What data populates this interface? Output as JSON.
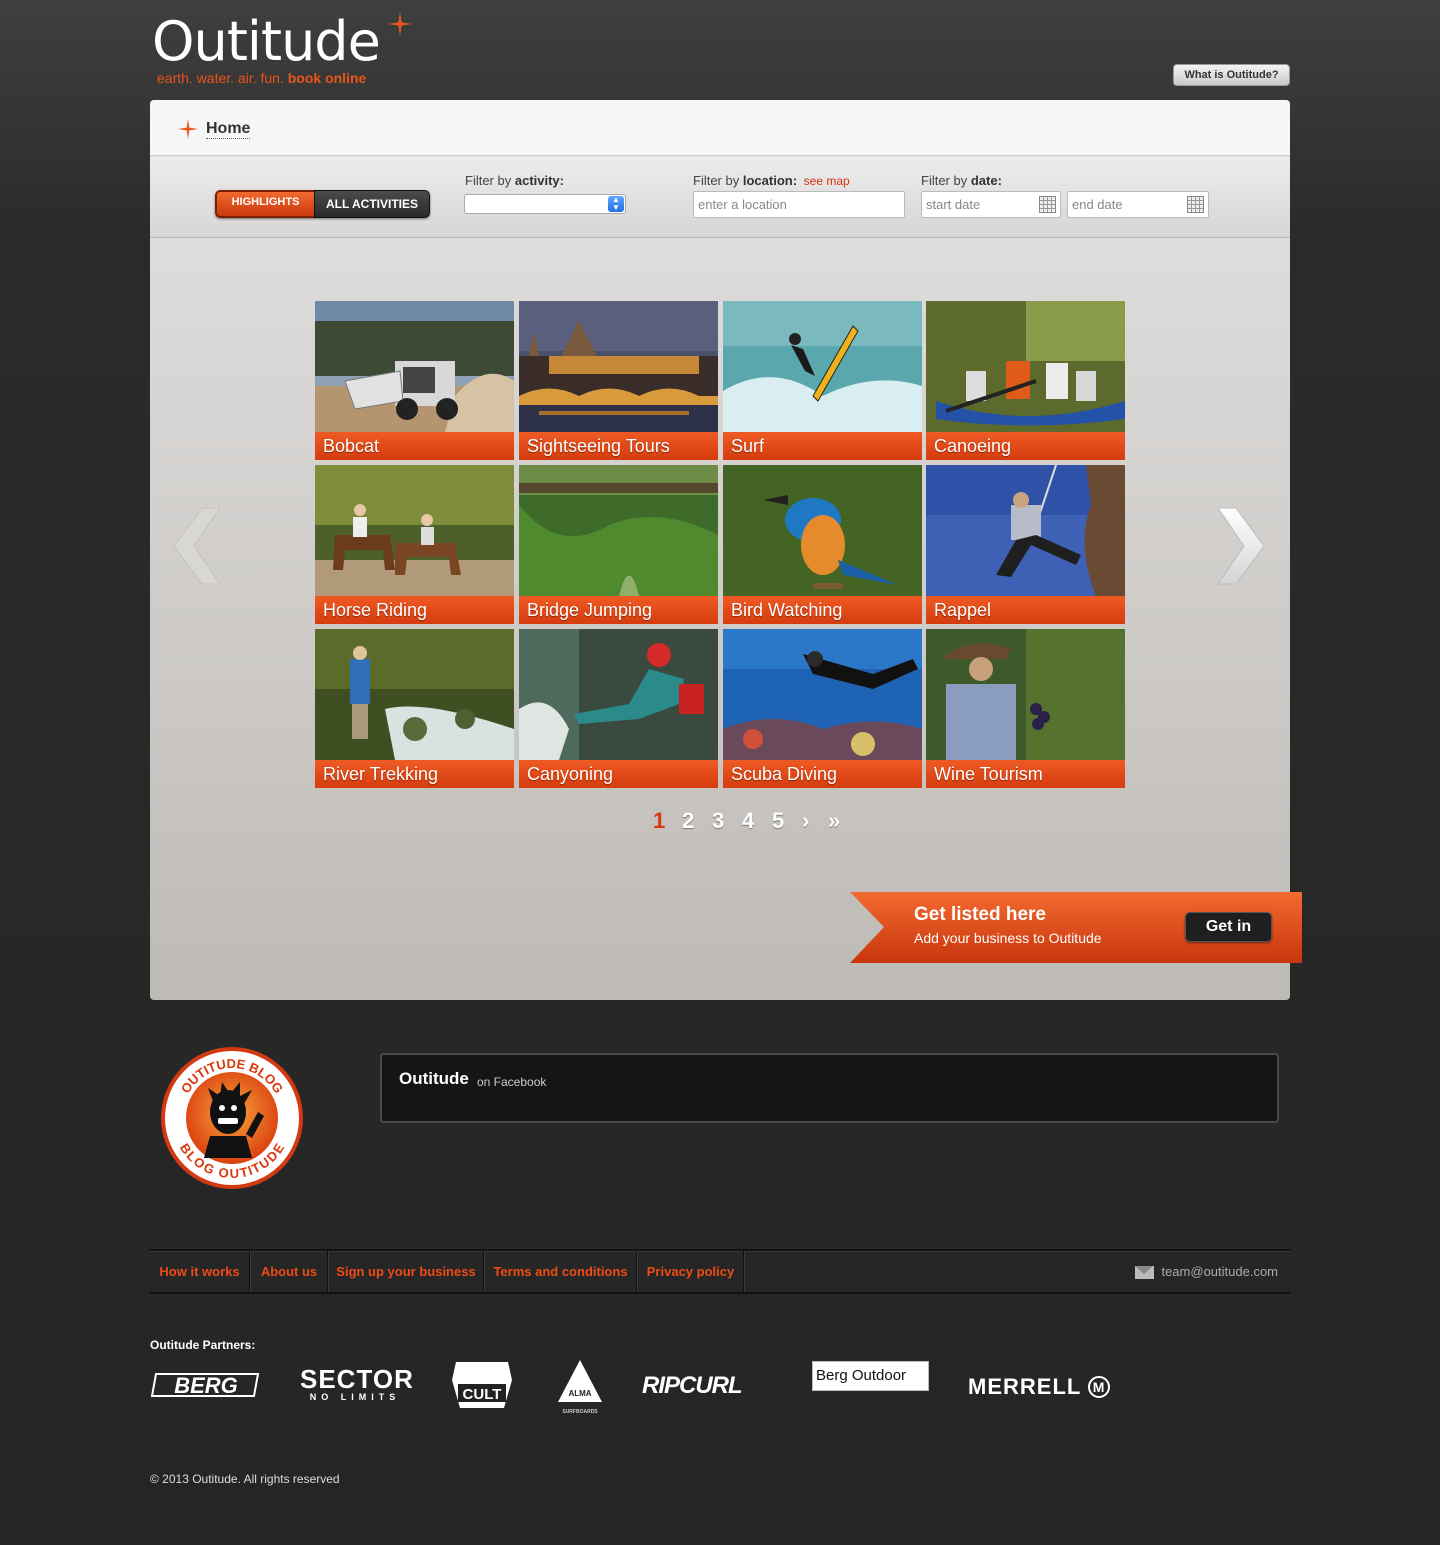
{
  "header": {
    "logo_text": "Outitude",
    "tagline_plain": "earth. water. air. fun.",
    "tagline_bold": "book online",
    "what_button": "What is Outitude?"
  },
  "breadcrumb": {
    "label": "Home"
  },
  "filters": {
    "toggle": {
      "highlights": "HIGHLIGHTS",
      "all": "ALL ACTIVITIES"
    },
    "activity": {
      "label_prefix": "Filter by",
      "label_bold": "activity:",
      "value": ""
    },
    "location": {
      "label_prefix": "Filter by",
      "label_bold": "location:",
      "map_link": "see map",
      "placeholder": "enter a location"
    },
    "date": {
      "label_prefix": "Filter by",
      "label_bold": "date:",
      "start_placeholder": "start date",
      "end_placeholder": "end date"
    }
  },
  "activities": [
    {
      "name": "Bobcat",
      "icon": "bobcat-photo"
    },
    {
      "name": "Sightseeing Tours",
      "icon": "city-night-photo"
    },
    {
      "name": "Surf",
      "icon": "surfer-photo"
    },
    {
      "name": "Canoeing",
      "icon": "canoe-photo"
    },
    {
      "name": "Horse Riding",
      "icon": "horse-riding-photo"
    },
    {
      "name": "Bridge Jumping",
      "icon": "bridge-gorge-photo"
    },
    {
      "name": "Bird Watching",
      "icon": "kingfisher-photo"
    },
    {
      "name": "Rappel",
      "icon": "rappel-photo"
    },
    {
      "name": "River Trekking",
      "icon": "river-trek-photo"
    },
    {
      "name": "Canyoning",
      "icon": "canyoning-photo"
    },
    {
      "name": "Scuba Diving",
      "icon": "scuba-photo"
    },
    {
      "name": "Wine Tourism",
      "icon": "vineyard-photo"
    }
  ],
  "pagination": {
    "first": "«",
    "prev": "‹",
    "pages": [
      "1",
      "2",
      "3",
      "4",
      "5"
    ],
    "current": "1",
    "next": "›",
    "last": "»"
  },
  "listing_banner": {
    "title": "Get listed here",
    "subtitle": "Add your business to Outitude",
    "button": "Get in"
  },
  "blog_badge": {
    "top_text": "OUTITUDE BLOG",
    "bottom_text": "BLOG OUTITUDE"
  },
  "facebook": {
    "title": "Outitude",
    "suffix": "on Facebook"
  },
  "footer_nav": [
    "How it works",
    "About us",
    "Sign up your business",
    "Terms and conditions",
    "Privacy policy"
  ],
  "contact_email": "team@outitude.com",
  "partners": {
    "title": "Outitude Partners:",
    "logos": [
      "BERG",
      "SECTOR",
      "NO LIMITS",
      "CULT",
      "ALMA",
      "SURFBOARDS",
      "RIPCURL",
      "Berg Outdoor",
      "MERRELL"
    ]
  },
  "copyright": "© 2013 Outitude. All rights reserved",
  "colors": {
    "accent": "#ea5319",
    "caption": "#d8400f",
    "page_bg": "#2a2a2a"
  }
}
